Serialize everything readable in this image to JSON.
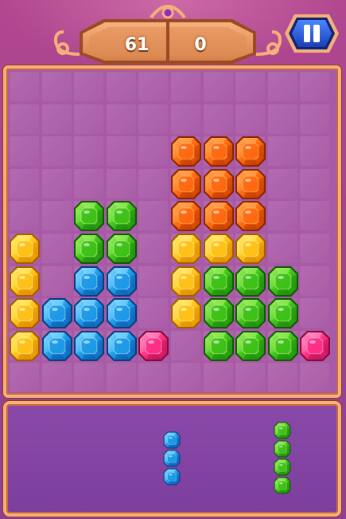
{
  "header": {
    "score_left": "61",
    "score_right": "0"
  },
  "controls": {
    "pause_icon": "pause-icon",
    "pause_color": "#1f4fd6"
  },
  "board": {
    "rows": 10,
    "cols": 10,
    "gems": [
      {
        "row": 2,
        "col": 5,
        "color": "orange"
      },
      {
        "row": 2,
        "col": 6,
        "color": "orange"
      },
      {
        "row": 2,
        "col": 7,
        "color": "orange"
      },
      {
        "row": 3,
        "col": 5,
        "color": "orange"
      },
      {
        "row": 3,
        "col": 6,
        "color": "orange"
      },
      {
        "row": 3,
        "col": 7,
        "color": "orange"
      },
      {
        "row": 4,
        "col": 2,
        "color": "green"
      },
      {
        "row": 4,
        "col": 3,
        "color": "green"
      },
      {
        "row": 4,
        "col": 5,
        "color": "orange"
      },
      {
        "row": 4,
        "col": 6,
        "color": "orange"
      },
      {
        "row": 4,
        "col": 7,
        "color": "orange"
      },
      {
        "row": 5,
        "col": 0,
        "color": "yellow"
      },
      {
        "row": 5,
        "col": 2,
        "color": "green"
      },
      {
        "row": 5,
        "col": 3,
        "color": "green"
      },
      {
        "row": 5,
        "col": 5,
        "color": "yellow"
      },
      {
        "row": 5,
        "col": 6,
        "color": "yellow"
      },
      {
        "row": 5,
        "col": 7,
        "color": "yellow"
      },
      {
        "row": 6,
        "col": 0,
        "color": "yellow"
      },
      {
        "row": 6,
        "col": 2,
        "color": "blue"
      },
      {
        "row": 6,
        "col": 3,
        "color": "blue"
      },
      {
        "row": 6,
        "col": 5,
        "color": "yellow"
      },
      {
        "row": 6,
        "col": 6,
        "color": "green"
      },
      {
        "row": 6,
        "col": 7,
        "color": "green"
      },
      {
        "row": 6,
        "col": 8,
        "color": "green"
      },
      {
        "row": 7,
        "col": 0,
        "color": "yellow"
      },
      {
        "row": 7,
        "col": 1,
        "color": "blue"
      },
      {
        "row": 7,
        "col": 2,
        "color": "blue"
      },
      {
        "row": 7,
        "col": 3,
        "color": "blue"
      },
      {
        "row": 7,
        "col": 5,
        "color": "yellow"
      },
      {
        "row": 7,
        "col": 6,
        "color": "green"
      },
      {
        "row": 7,
        "col": 7,
        "color": "green"
      },
      {
        "row": 7,
        "col": 8,
        "color": "green"
      },
      {
        "row": 8,
        "col": 0,
        "color": "yellow"
      },
      {
        "row": 8,
        "col": 1,
        "color": "blue"
      },
      {
        "row": 8,
        "col": 2,
        "color": "blue"
      },
      {
        "row": 8,
        "col": 3,
        "color": "blue"
      },
      {
        "row": 8,
        "col": 4,
        "color": "pink"
      },
      {
        "row": 8,
        "col": 6,
        "color": "green"
      },
      {
        "row": 8,
        "col": 7,
        "color": "green"
      },
      {
        "row": 8,
        "col": 8,
        "color": "green"
      },
      {
        "row": 8,
        "col": 9,
        "color": "pink"
      }
    ]
  },
  "tray": {
    "pieces": [
      {
        "name": "tray-piece-blue-i3",
        "color": "blue",
        "length": 3
      },
      {
        "name": "tray-piece-green-i4",
        "color": "green",
        "length": 4
      }
    ]
  },
  "gem_colors": {
    "orange": {
      "light": "#ffb15a",
      "mid": "#ff6a12",
      "dark": "#c23a00",
      "edge": "#8a2600"
    },
    "green": {
      "light": "#a8f56a",
      "mid": "#3fc21a",
      "dark": "#1e8a0c",
      "edge": "#0f5a06"
    },
    "yellow": {
      "light": "#fff07a",
      "mid": "#ffc21a",
      "dark": "#e08a00",
      "edge": "#a45e00"
    },
    "blue": {
      "light": "#8fe0ff",
      "mid": "#1f9be8",
      "dark": "#0a5fb5",
      "edge": "#083d80"
    },
    "pink": {
      "light": "#ff9cc8",
      "mid": "#ff2f86",
      "dark": "#c0125a",
      "edge": "#86083c"
    }
  }
}
